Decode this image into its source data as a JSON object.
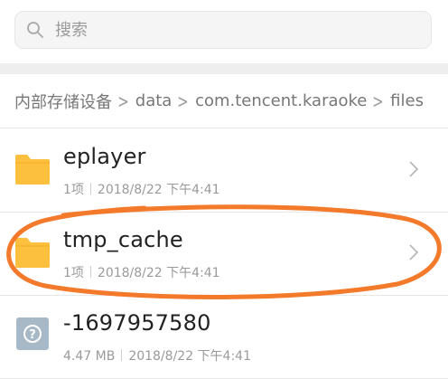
{
  "search": {
    "placeholder": "搜索",
    "icon": "search-icon"
  },
  "breadcrumb": {
    "items": [
      "内部存储设备",
      "data",
      "com.tencent.karaoke",
      "files"
    ],
    "separator": ">"
  },
  "files": [
    {
      "name": "eplayer",
      "type": "folder",
      "count": "1项",
      "date": "2018/8/22 下午4:41",
      "icon": "folder-icon"
    },
    {
      "name": "tmp_cache",
      "type": "folder",
      "count": "1项",
      "date": "2018/8/22 下午4:41",
      "icon": "folder-icon"
    },
    {
      "name": "-1697957580",
      "type": "unknown-file",
      "size": "4.47 MB",
      "date": "2018/8/22 下午4:41",
      "icon": "unknown-file-icon"
    }
  ],
  "colors": {
    "folder": "#FDBF3E",
    "unknown_file": "#A7B8C6",
    "annotation": "#F37A2B",
    "divider": "#E8E8E8",
    "band": "#EEEEEE"
  }
}
